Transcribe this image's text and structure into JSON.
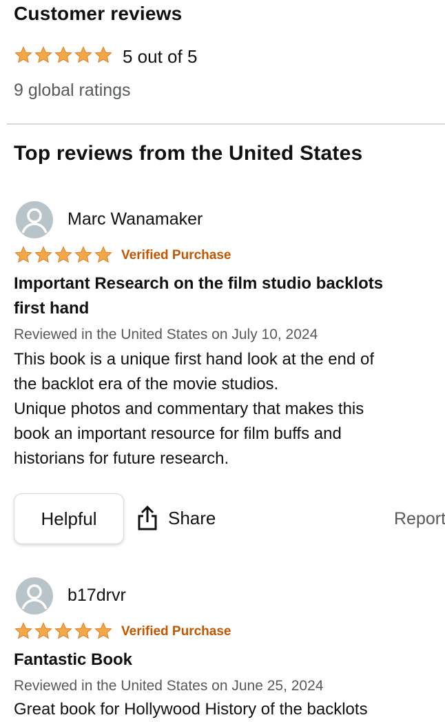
{
  "header": {
    "title": "Customer reviews",
    "rating_text": "5 out of 5",
    "global_ratings": "9 global ratings",
    "star_color": "#f3a847"
  },
  "section_title": "Top reviews from the United States",
  "reviews": [
    {
      "author": "Marc Wanamaker",
      "stars": 5,
      "verified": "Verified Purchase",
      "title_line1": "Important Research on the film studio backlots",
      "title_line2": "first hand",
      "reviewed": "Reviewed in the United States on July 10, 2024",
      "body": [
        "This book is a unique first hand look at the end of",
        "the backlot era of the movie studios.",
        "Unique photos and commentary that makes this",
        "book an important resource for film buffs and",
        "historians for future research."
      ],
      "helpful": "Helpful",
      "share": "Share",
      "report": "Report"
    },
    {
      "author": "b17drvr",
      "stars": 5,
      "verified": "Verified Purchase",
      "title": "Fantastic Book",
      "reviewed": "Reviewed in the United States on June 25, 2024",
      "body_first_line": "Great book for Hollywood History of the backlots"
    }
  ],
  "icons": {
    "star": "star-icon",
    "avatar": "person-avatar-icon",
    "share": "share-icon"
  }
}
